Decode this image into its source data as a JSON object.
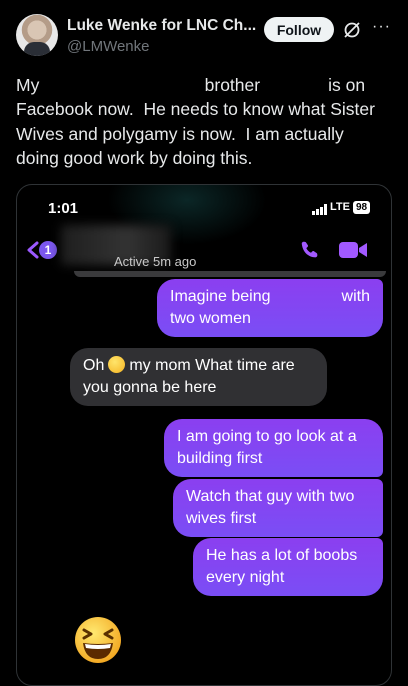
{
  "tweet": {
    "author_name": "Luke Wenke for LNC Ch...",
    "handle": "@LMWenke",
    "follow_label": "Follow",
    "more_label": "···",
    "text_lines": [
      "My                                  brother              is on",
      "Facebook now.  He needs to know what Sister",
      "Wives and polygamy is now.  I am actually",
      "doing good work by doing this."
    ]
  },
  "screenshot": {
    "status_time": "1:01",
    "network": "LTE",
    "battery": "98",
    "back_badge": "1",
    "active_status": "Active 5m ago",
    "messages": [
      {
        "side": "out",
        "line1_a": "Imagine being",
        "line1_b": "with",
        "line2": "two women"
      },
      {
        "side": "in",
        "pre": "Oh",
        "post": "my mom What time are",
        "line2": "you gonna be here"
      },
      {
        "side": "out",
        "text": "I am going to go look at a building first"
      },
      {
        "side": "out",
        "text": "Watch that guy with two wives first"
      },
      {
        "side": "out",
        "text": "He has a lot of boobs every night"
      }
    ]
  },
  "colors": {
    "background": "#000000",
    "text": "#e7e9ea",
    "muted": "#71767b",
    "messenger_purple": "#8b3ff0",
    "incoming_bubble": "#303033"
  },
  "icons": [
    "avatar",
    "notifications-off-icon",
    "more-icon",
    "signal-icon",
    "back-chevron-icon",
    "phone-icon",
    "video-icon",
    "grinning-squint-emoji"
  ]
}
